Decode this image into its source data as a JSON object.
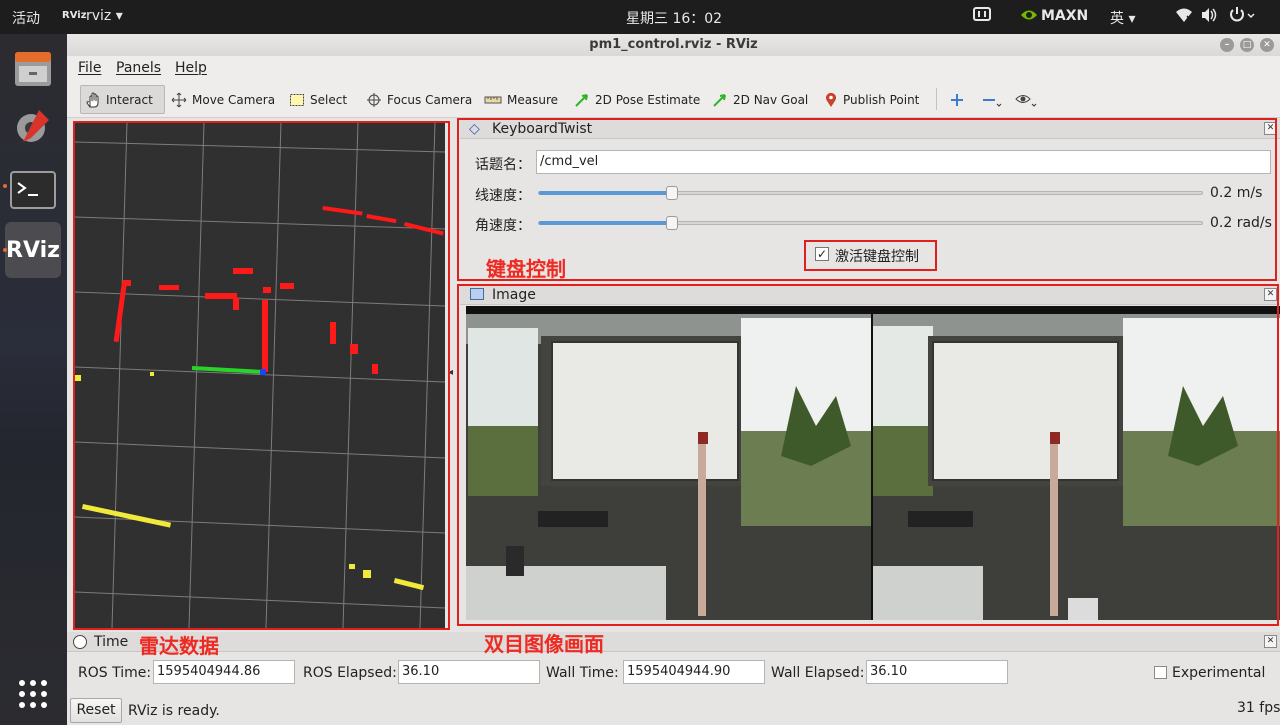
{
  "topbar": {
    "activities": "活动",
    "app_icon": "rviz-app-icon",
    "app_name": "rviz",
    "clock": "星期三 16：02",
    "power_mode": "MAXN",
    "input_method": "英",
    "icons": [
      "keyboard-icon",
      "nvidia-icon",
      "network-icon",
      "volume-icon",
      "power-icon"
    ]
  },
  "dock": {
    "items": [
      "file-manager-icon",
      "settings-icon",
      "terminal-icon",
      "rviz-icon"
    ],
    "rviz_label": "RViz",
    "apps_grid": "show-applications-icon"
  },
  "window": {
    "title": "pm1_control.rviz - RViz"
  },
  "menu": [
    "File",
    "Panels",
    "Help"
  ],
  "toolbar": {
    "tools": [
      {
        "label": "Interact",
        "icon": "hand-icon",
        "active": true
      },
      {
        "label": "Move Camera",
        "icon": "move-icon"
      },
      {
        "label": "Select",
        "icon": "select-box-icon"
      },
      {
        "label": "Focus Camera",
        "icon": "crosshair-icon"
      },
      {
        "label": "Measure",
        "icon": "ruler-icon"
      },
      {
        "label": "2D Pose Estimate",
        "icon": "pose-arrow-icon"
      },
      {
        "label": "2D Nav Goal",
        "icon": "nav-arrow-icon"
      },
      {
        "label": "Publish Point",
        "icon": "pin-icon"
      }
    ],
    "extra_icons": [
      "plus-icon",
      "minus-icon",
      "eye-icon"
    ]
  },
  "keyboard_panel": {
    "title": "KeyboardTwist",
    "topic_label": "话题名：",
    "topic_value": "/cmd_vel",
    "linear_label": "线速度：",
    "linear_value": "0.2 m/s",
    "linear_fraction": 0.2,
    "angular_label": "角速度：",
    "angular_value": "0.2 rad/s",
    "angular_fraction": 0.2,
    "activate_label": "激活键盘控制",
    "activate_checked": true
  },
  "image_panel": {
    "title": "Image"
  },
  "time_panel": {
    "title": "Time",
    "ros_time_label": "ROS Time:",
    "ros_time": "1595404944.86",
    "ros_elapsed_label": "ROS Elapsed:",
    "ros_elapsed": "36.10",
    "wall_time_label": "Wall Time:",
    "wall_time": "1595404944.90",
    "wall_elapsed_label": "Wall Elapsed:",
    "wall_elapsed": "36.10",
    "experimental_label": "Experimental"
  },
  "status": {
    "reset_label": "Reset",
    "message": "RViz is ready.",
    "fps": "31 fps"
  },
  "annotations": {
    "lidar": "雷达数据",
    "keyboard": "键盘控制",
    "stereo": "双目图像画面"
  },
  "colors": {
    "annotation_red": "#e0201e",
    "lidar_red": "#ff1a1a",
    "lidar_yellow": "#f2ea3a",
    "slider_blue": "#5c97d6",
    "viewport_bg": "#303030"
  }
}
